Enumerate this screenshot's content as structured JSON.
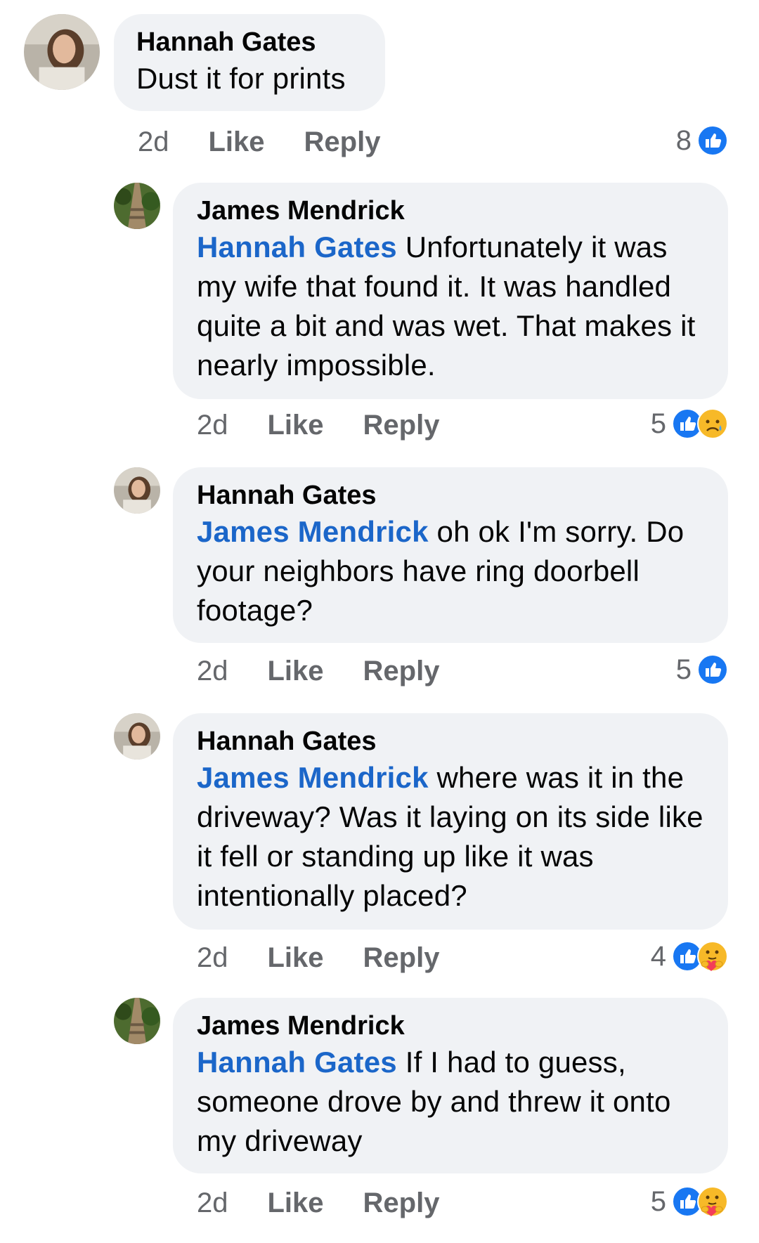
{
  "actions": {
    "like_label": "Like",
    "reply_label": "Reply"
  },
  "comments": [
    {
      "author": "Hannah Gates",
      "mention": "",
      "text": "Dust it for prints",
      "time": "2d",
      "reaction_count": "8",
      "reactions": [
        "like-icon"
      ]
    },
    {
      "author": "James Mendrick",
      "mention": "Hannah Gates",
      "text": " Unfortunately it was my wife that found it. It was handled quite a bit and was wet. That makes it nearly impossible.",
      "time": "2d",
      "reaction_count": "5",
      "reactions": [
        "like-icon",
        "sad-icon"
      ]
    },
    {
      "author": "Hannah Gates",
      "mention": "James Mendrick",
      "text": " oh ok I'm sorry. Do your neighbors have ring doorbell footage?",
      "time": "2d",
      "reaction_count": "5",
      "reactions": [
        "like-icon"
      ]
    },
    {
      "author": "Hannah Gates",
      "mention": "James Mendrick",
      "text": " where was it in the driveway? Was it laying on its side like it fell or standing up like it was intentionally placed?",
      "time": "2d",
      "reaction_count": "4",
      "reactions": [
        "like-icon",
        "care-icon"
      ]
    },
    {
      "author": "James Mendrick",
      "mention": "Hannah Gates",
      "text": " If I had to guess, someone drove by and threw it onto my driveway",
      "time": "2d",
      "reaction_count": "5",
      "reactions": [
        "like-icon",
        "care-icon"
      ]
    }
  ],
  "colors": {
    "bubble": "#f0f2f5",
    "mention": "#1b66c9",
    "like_blue": "#1877f2",
    "meta_gray": "#65676b"
  }
}
